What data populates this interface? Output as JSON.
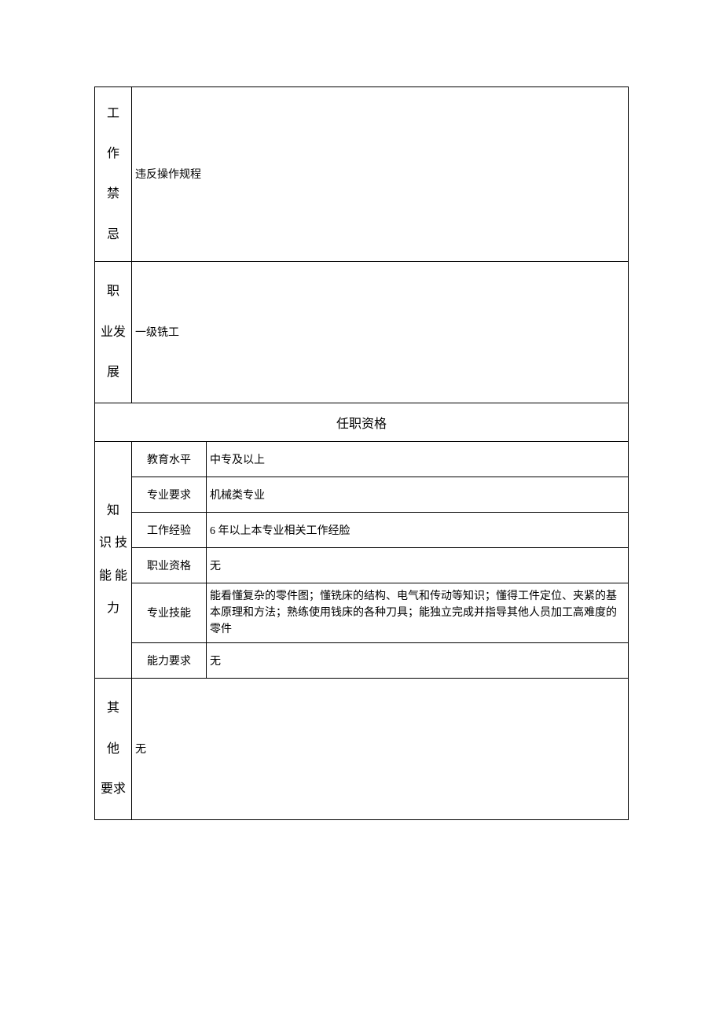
{
  "rows": {
    "taboo": {
      "label_chars": [
        "工",
        "作",
        "禁",
        "忌"
      ],
      "value": "违反操作规程"
    },
    "career": {
      "label_chars": [
        "职",
        "业发",
        "展"
      ],
      "value": "一级铣工"
    }
  },
  "qualification_header": "任职资格",
  "knowledge": {
    "label_chars": [
      "知",
      "识 技",
      "能 能",
      "力"
    ],
    "items": [
      {
        "label": "教育水平",
        "value": "中专及以上"
      },
      {
        "label": "专业要求",
        "value": "机械类专业"
      },
      {
        "label": "工作经验",
        "value": "6 年以上本专业相关工作经脸"
      },
      {
        "label": "职业资格",
        "value": "无"
      },
      {
        "label": "专业技能",
        "value": "能看懂复杂的零件图；懂铣床的结构、电气和传动等知识；懂得工件定位、夹紧的基本原理和方法；熟练使用钱床的各种刀具；能独立完成并指导其他人员加工高难度的零件"
      },
      {
        "label": "能力要求",
        "value": "无"
      }
    ]
  },
  "other": {
    "label_chars": [
      "其",
      "他",
      "要求"
    ],
    "value": "无"
  }
}
